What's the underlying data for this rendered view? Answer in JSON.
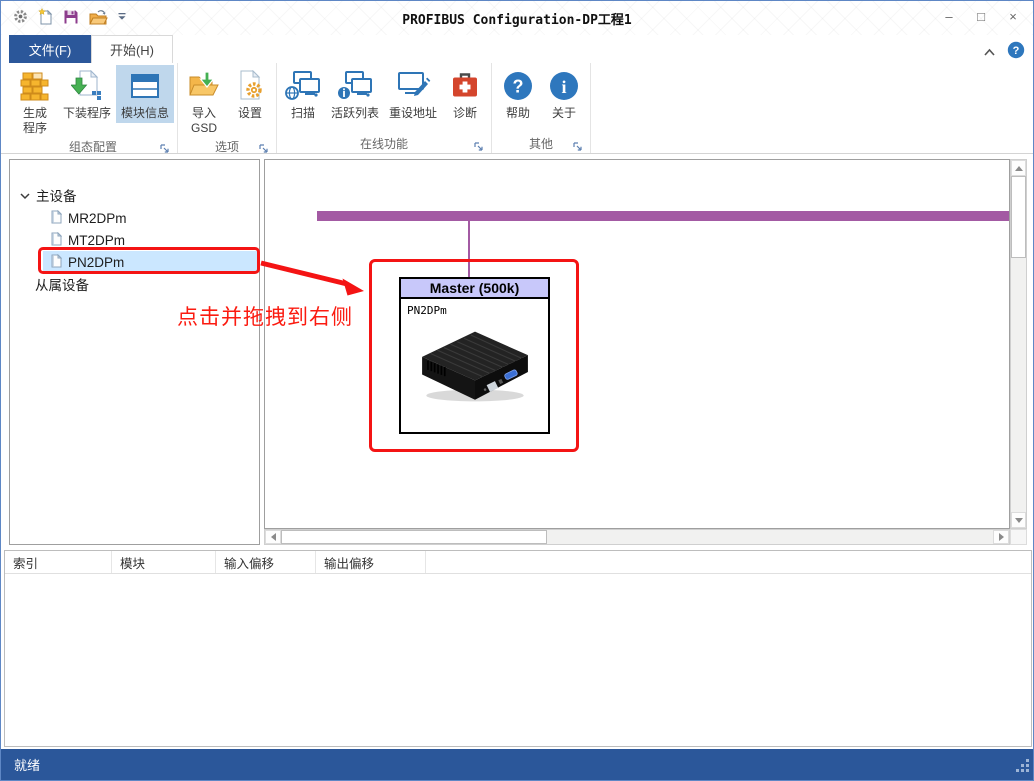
{
  "window": {
    "title": "PROFIBUS Configuration-DP工程1",
    "minimize": "–",
    "maximize": "□",
    "close": "×"
  },
  "tabs": {
    "file": "文件(F)",
    "home": "开始(H)"
  },
  "ribbon": {
    "groups": [
      {
        "label": "组态配置",
        "buttons": [
          {
            "label": "生成\n程序",
            "icon": "bricks-icon"
          },
          {
            "label": "下装程序",
            "icon": "download-program-icon"
          },
          {
            "label": "模块信息",
            "icon": "module-info-icon",
            "highlighted": true
          }
        ]
      },
      {
        "label": "选项",
        "buttons": [
          {
            "label": "导入\nGSD",
            "icon": "import-gsd-icon"
          },
          {
            "label": "设置",
            "icon": "settings-icon"
          }
        ]
      },
      {
        "label": "在线功能",
        "buttons": [
          {
            "label": "扫描",
            "icon": "scan-icon"
          },
          {
            "label": "活跃列表",
            "icon": "active-list-icon"
          },
          {
            "label": "重设地址",
            "icon": "reset-address-icon"
          },
          {
            "label": "诊断",
            "icon": "diagnosis-icon"
          }
        ]
      },
      {
        "label": "其他",
        "buttons": [
          {
            "label": "帮助",
            "icon": "help-icon"
          },
          {
            "label": "关于",
            "icon": "about-icon"
          }
        ]
      }
    ]
  },
  "tree": {
    "master_group": "主设备",
    "devices": [
      {
        "label": "MR2DPm"
      },
      {
        "label": "MT2DPm"
      },
      {
        "label": "PN2DPm",
        "selected": true
      }
    ],
    "slave_group": "从属设备"
  },
  "annotation": {
    "drag_hint": "点击并拖拽到右侧"
  },
  "canvas": {
    "master_title": "Master (500k)",
    "master_device": "PN2DPm",
    "bus_color": "#a35aa3",
    "highlight_color": "#f41414"
  },
  "table": {
    "columns": [
      "索引",
      "模块",
      "输入偏移",
      "输出偏移"
    ],
    "rows": []
  },
  "status": {
    "text": "就绪"
  },
  "colors": {
    "accent_blue": "#2b579a",
    "tree_selection": "#cbe7ff",
    "ribbon_highlight": "#bfd7ec",
    "master_header": "#c8c8fa"
  }
}
